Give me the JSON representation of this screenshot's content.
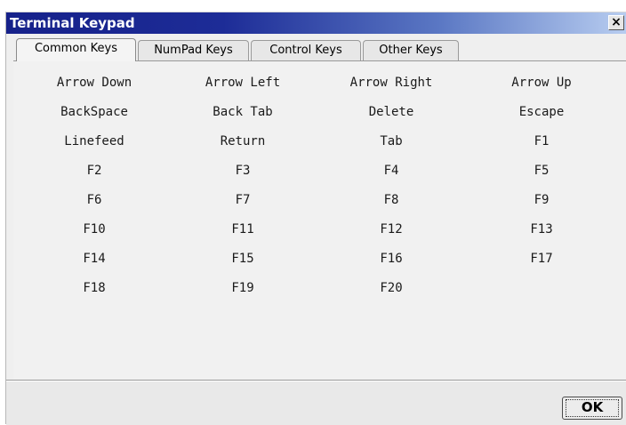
{
  "window": {
    "title": "Terminal Keypad",
    "close_label": "×"
  },
  "tabs": [
    {
      "label": "Common Keys",
      "active": true
    },
    {
      "label": "NumPad Keys",
      "active": false
    },
    {
      "label": "Control Keys",
      "active": false
    },
    {
      "label": "Other Keys",
      "active": false
    }
  ],
  "keys": [
    [
      "Arrow Down",
      "Arrow Left",
      "Arrow Right",
      "Arrow Up"
    ],
    [
      "BackSpace",
      "Back Tab",
      "Delete",
      "Escape"
    ],
    [
      "Linefeed",
      "Return",
      "Tab",
      "F1"
    ],
    [
      "F2",
      "F3",
      "F4",
      "F5"
    ],
    [
      "F6",
      "F7",
      "F8",
      "F9"
    ],
    [
      "F10",
      "F11",
      "F12",
      "F13"
    ],
    [
      "F14",
      "F15",
      "F16",
      "F17"
    ],
    [
      "F18",
      "F19",
      "F20"
    ]
  ],
  "footer": {
    "ok_label": "OK"
  }
}
